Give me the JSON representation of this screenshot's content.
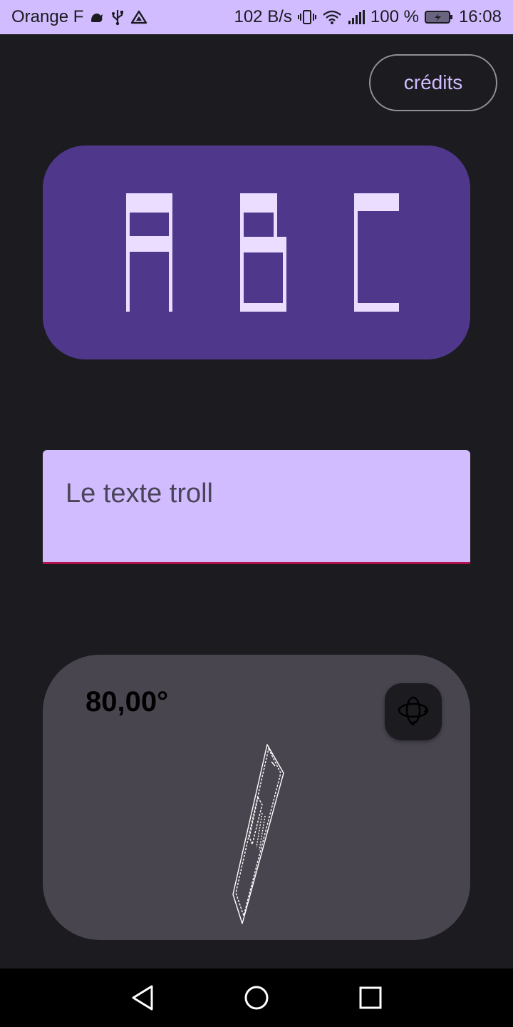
{
  "status_bar": {
    "carrier": "Orange F",
    "net_speed": "102 B/s",
    "battery": "100 %",
    "time": "16:08",
    "icons": [
      "cat-icon",
      "usb-icon",
      "drive-icon",
      "vibrate-icon",
      "wifi-icon",
      "signal-icon",
      "battery-icon"
    ]
  },
  "credits_button": {
    "label": "crédits"
  },
  "abc_display": {
    "letters": [
      "A",
      "B",
      "C"
    ],
    "color": "#eaddff",
    "background": "#4f378b"
  },
  "text_field": {
    "value": "Le texte troll"
  },
  "gyro": {
    "angle": "80,00°",
    "button_icon": "rotation-3d-icon"
  },
  "navigation": {
    "icons": [
      "back-icon",
      "home-icon",
      "recents-icon"
    ]
  },
  "colors": {
    "accent": "#d0bcff",
    "background": "#1c1b1f",
    "card_purple": "#4f378b",
    "card_gray": "#49454f",
    "underline": "#b3124d"
  }
}
